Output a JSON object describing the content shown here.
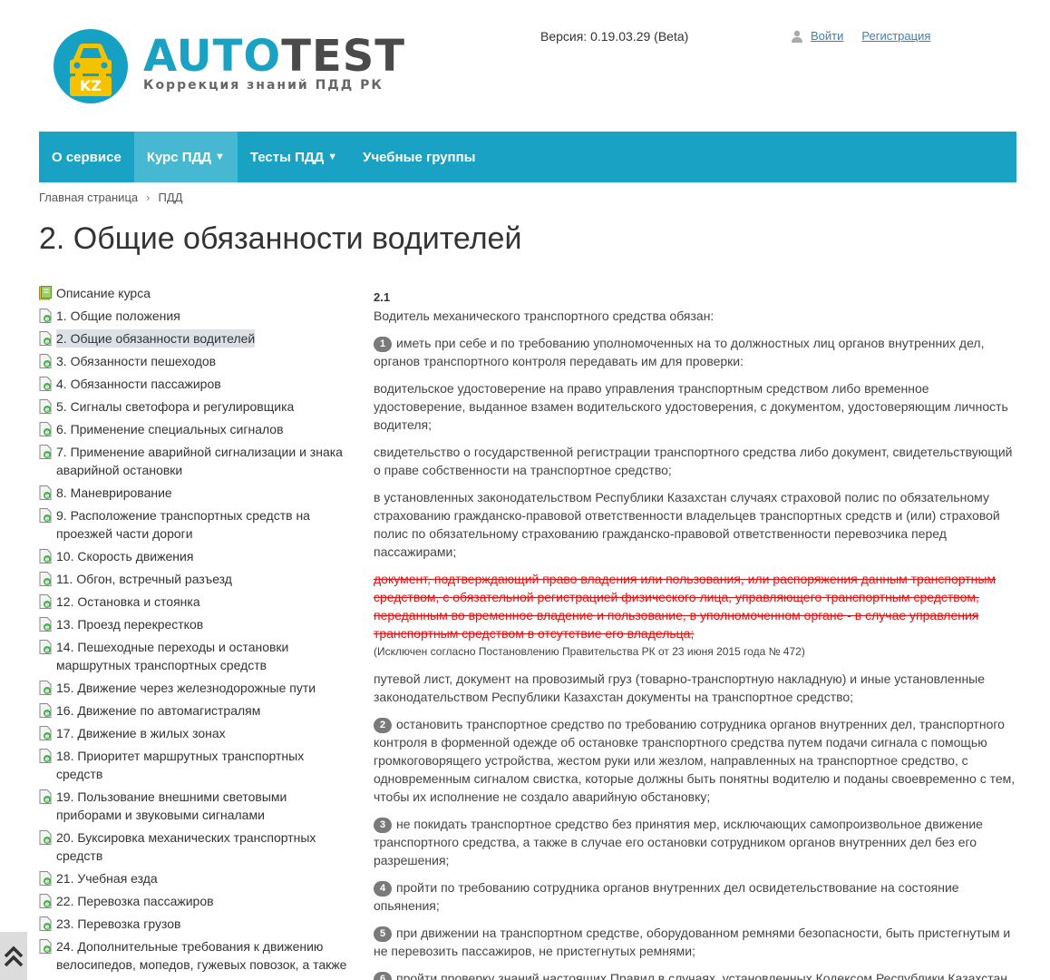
{
  "brand": {
    "auto": "AUTO",
    "test": "TEST",
    "subtitle": "Коррекция знаний ПДД РК",
    "badge": "KZ",
    "colors": {
      "primary": "#1aa2c4",
      "badge": "#f5c200"
    }
  },
  "header": {
    "version": "Версия: 0.19.03.29 (Beta)",
    "login": "Войти",
    "register": "Регистрация"
  },
  "nav": [
    {
      "label": "О сервисе"
    },
    {
      "label": "Курс ПДД"
    },
    {
      "label": "Тесты ПДД"
    },
    {
      "label": "Учебные группы"
    }
  ],
  "breadcrumb": {
    "home": "Главная страница",
    "current": "ПДД"
  },
  "title": "2. Общие обязанности водителей",
  "sidebar": [
    "Описание курса",
    "1. Общие положения",
    "2. Общие обязанности водителей",
    "3. Обязанности пешеходов",
    "4. Обязанности пассажиров",
    "5. Сигналы светофора и регулировщика",
    "6. Применение специальных сигналов",
    "7. Применение аварийной сигнализации и знака аварийной остановки",
    "8. Маневрирование",
    "9. Расположение транспортных средств на проезжей части дороги",
    "10. Скорость движения",
    "11. Обгон, встречный разъезд",
    "12. Остановка и стоянка",
    "13. Проезд перекрестков",
    "14. Пешеходные переходы и остановки маршрутных транспортных средств",
    "15. Движение через железнодорожные пути",
    "16. Движение по автомагистралям",
    "17. Движение в жилых зонах",
    "18. Приоритет маршрутных транспортных средств",
    "19. Пользование внешними световыми приборами и звуковыми сигналами",
    "20. Буксировка механических транспортных средств",
    "21. Учебная езда",
    "22. Перевозка пассажиров",
    "23. Перевозка грузов",
    "24. Дополнительные требования к движению велосипедов, мопедов, гужевых повозок, а также"
  ],
  "content": {
    "section": "2.1",
    "intro": "Водитель механического транспортного средства обязан:",
    "item1": "иметь при себе и по требованию уполномоченных на то должностных лиц органов внутренних дел, органов транспортного контроля передавать им для проверки:",
    "p_license": "водительское удостоверение на право управления транспортным средством либо временное удостоверение, выданное взамен водительского удостоверения, с документом, удостоверяющим личность водителя;",
    "p_registration": "свидетельство о государственной регистрации транспортного средства либо документ, свидетельствующий о праве собственности на транспортное средство;",
    "p_insurance": "в установленных законодательством Республики Казахстан случаях страховой полис по обязательному страхованию гражданско-правовой ответственности владельцев транспортных средств и (или) страховой полис по обязательному страхованию гражданско-правовой ответственности перевозчика перед пассажирами;",
    "p_struck": "документ, подтверждающий право владения или пользования, или распоряжения данным транспортным средством, с обязательной регистрацией физического лица, управляющего транспортным средством, переданным во временное владение и пользование, в уполномоченном органе - в случае управления транспортным средством в отсутствие его владельца;",
    "p_note": "(Исключен согласно Постановлению Правительства РК от 23 июня 2015 года № 472)",
    "p_waybill": "путевой лист, документ на провозимый груз (товарно-транспортную накладную) и иные установленные законодательством Республики Казахстан документы на транспортное средство;",
    "item2": "остановить транспортное средство по требованию сотрудника органов внутренних дел, транспортного контроля в форменной одежде об остановке транспортного средства путем подачи сигнала с помощью громкоговорящего устройства, жестом руки или жезлом, направленных на транспортное средство, с одновременным сигналом свистка, которые должны быть понятны водителю и поданы своевременно с тем, чтобы их исполнение не создало аварийную обстановку;",
    "item3": "не покидать транспортное средство без принятия мер, исключающих самопроизвольное движение транспортного средства, а также в случае его остановки сотрудником органов внутренних дел без его разрешения;",
    "item4": "пройти по требованию сотрудника органов внутренних дел освидетельствование на состояние опьянения;",
    "item5": "при движении на транспортном средстве, оборудованном ремнями безопасности, быть пристегнутым и не перевозить пассажиров, не пристегнутых ремнями;",
    "item6": "пройти проверку знаний настоящих Правил в случаях, установленных Кодексом Республики Казахстан",
    "n1": "1",
    "n2": "2",
    "n3": "3",
    "n4": "4",
    "n5": "5",
    "n6": "6"
  }
}
